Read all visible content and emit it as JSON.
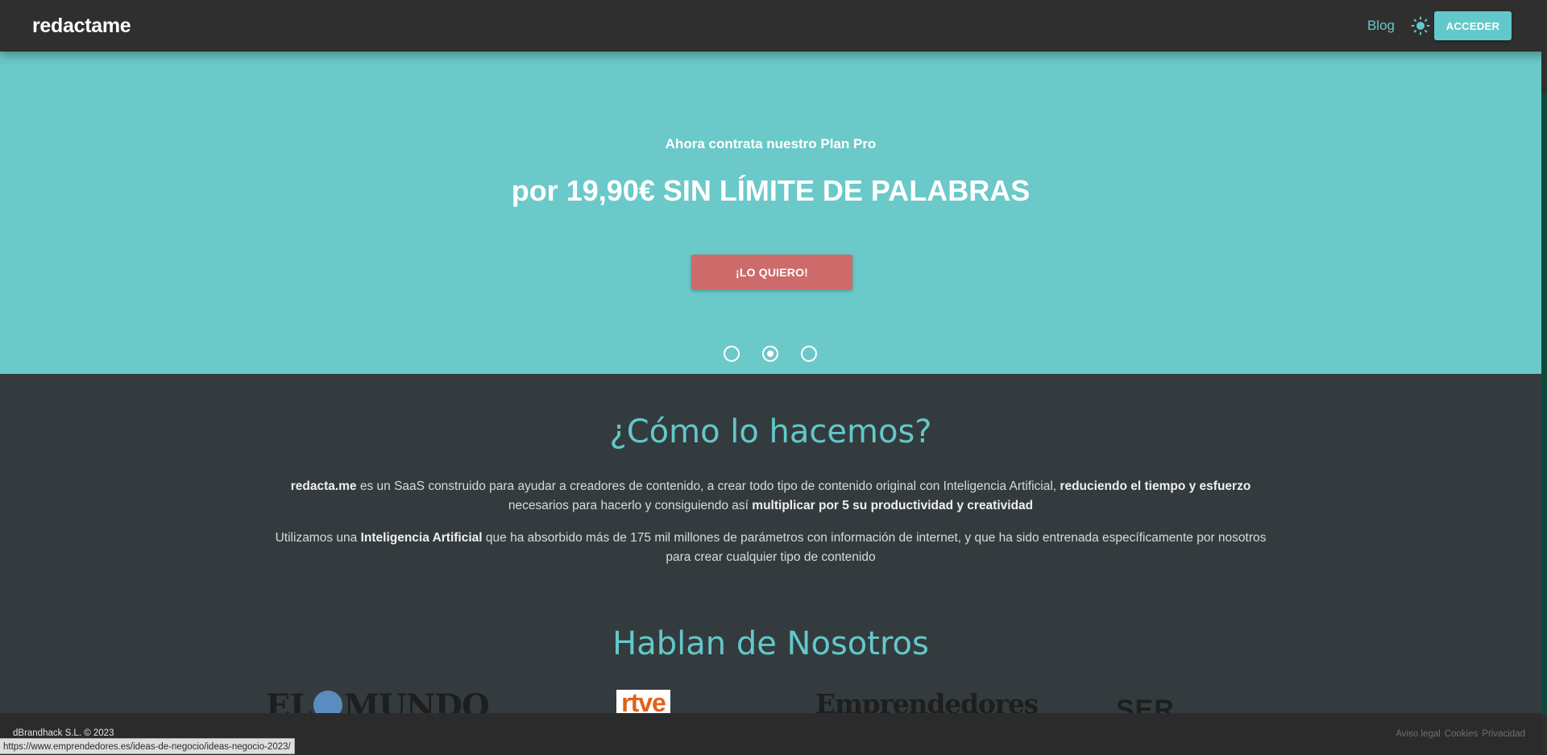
{
  "navbar": {
    "logo": "redactame",
    "blog_label": "Blog",
    "theme_icon": "sun-icon",
    "login_label": "ACCEDER"
  },
  "hero": {
    "subtitle": "Ahora contrata nuestro Plan Pro",
    "title": "por 19,90€ SIN LÍMITE DE PALABRAS",
    "cta_label": "¡LO QUIERO!",
    "slides": 3,
    "active_slide": 2
  },
  "how": {
    "title": "¿Cómo lo hacemos?",
    "p1": {
      "brand": "redacta.me",
      "t1": " es un SaaS construido para ayudar a creadores de contenido, a crear todo tipo de contenido original con Inteligencia Artificial, ",
      "b1": "reduciendo el tiempo y esfuerzo",
      "t2": " necesarios para hacerlo y consiguiendo así ",
      "b2": "multiplicar por 5 su productividad y creatividad"
    },
    "p2": {
      "t1": "Utilizamos una ",
      "b1": "Inteligencia Artificial",
      "t2": " que ha absorbido más de 175 mil millones de parámetros con información de internet, y que ha sido entrenada específicamente por nosotros para crear cualquier tipo de contenido"
    }
  },
  "press": {
    "title": "Hablan de Nosotros",
    "logos": {
      "elmundo_a": "EL",
      "elmundo_b": "MUNDO",
      "rtve": "rtve",
      "emprendedores": "Emprendedores",
      "ser": "SER"
    }
  },
  "footer": {
    "copyright": "dBrandhack S.L. © 2023",
    "links": [
      "Aviso legal",
      "Cookies",
      "Privacidad"
    ]
  },
  "status_bar": {
    "url": "https://www.emprendedores.es/ideas-de-negocio/ideas-negocio-2023/"
  },
  "colors": {
    "accent": "#63c8c9",
    "hero_bg": "#6bc9c9",
    "cta": "#cd6b6b",
    "section_bg": "#343b3e",
    "navbar_bg": "#2f2f2f"
  }
}
